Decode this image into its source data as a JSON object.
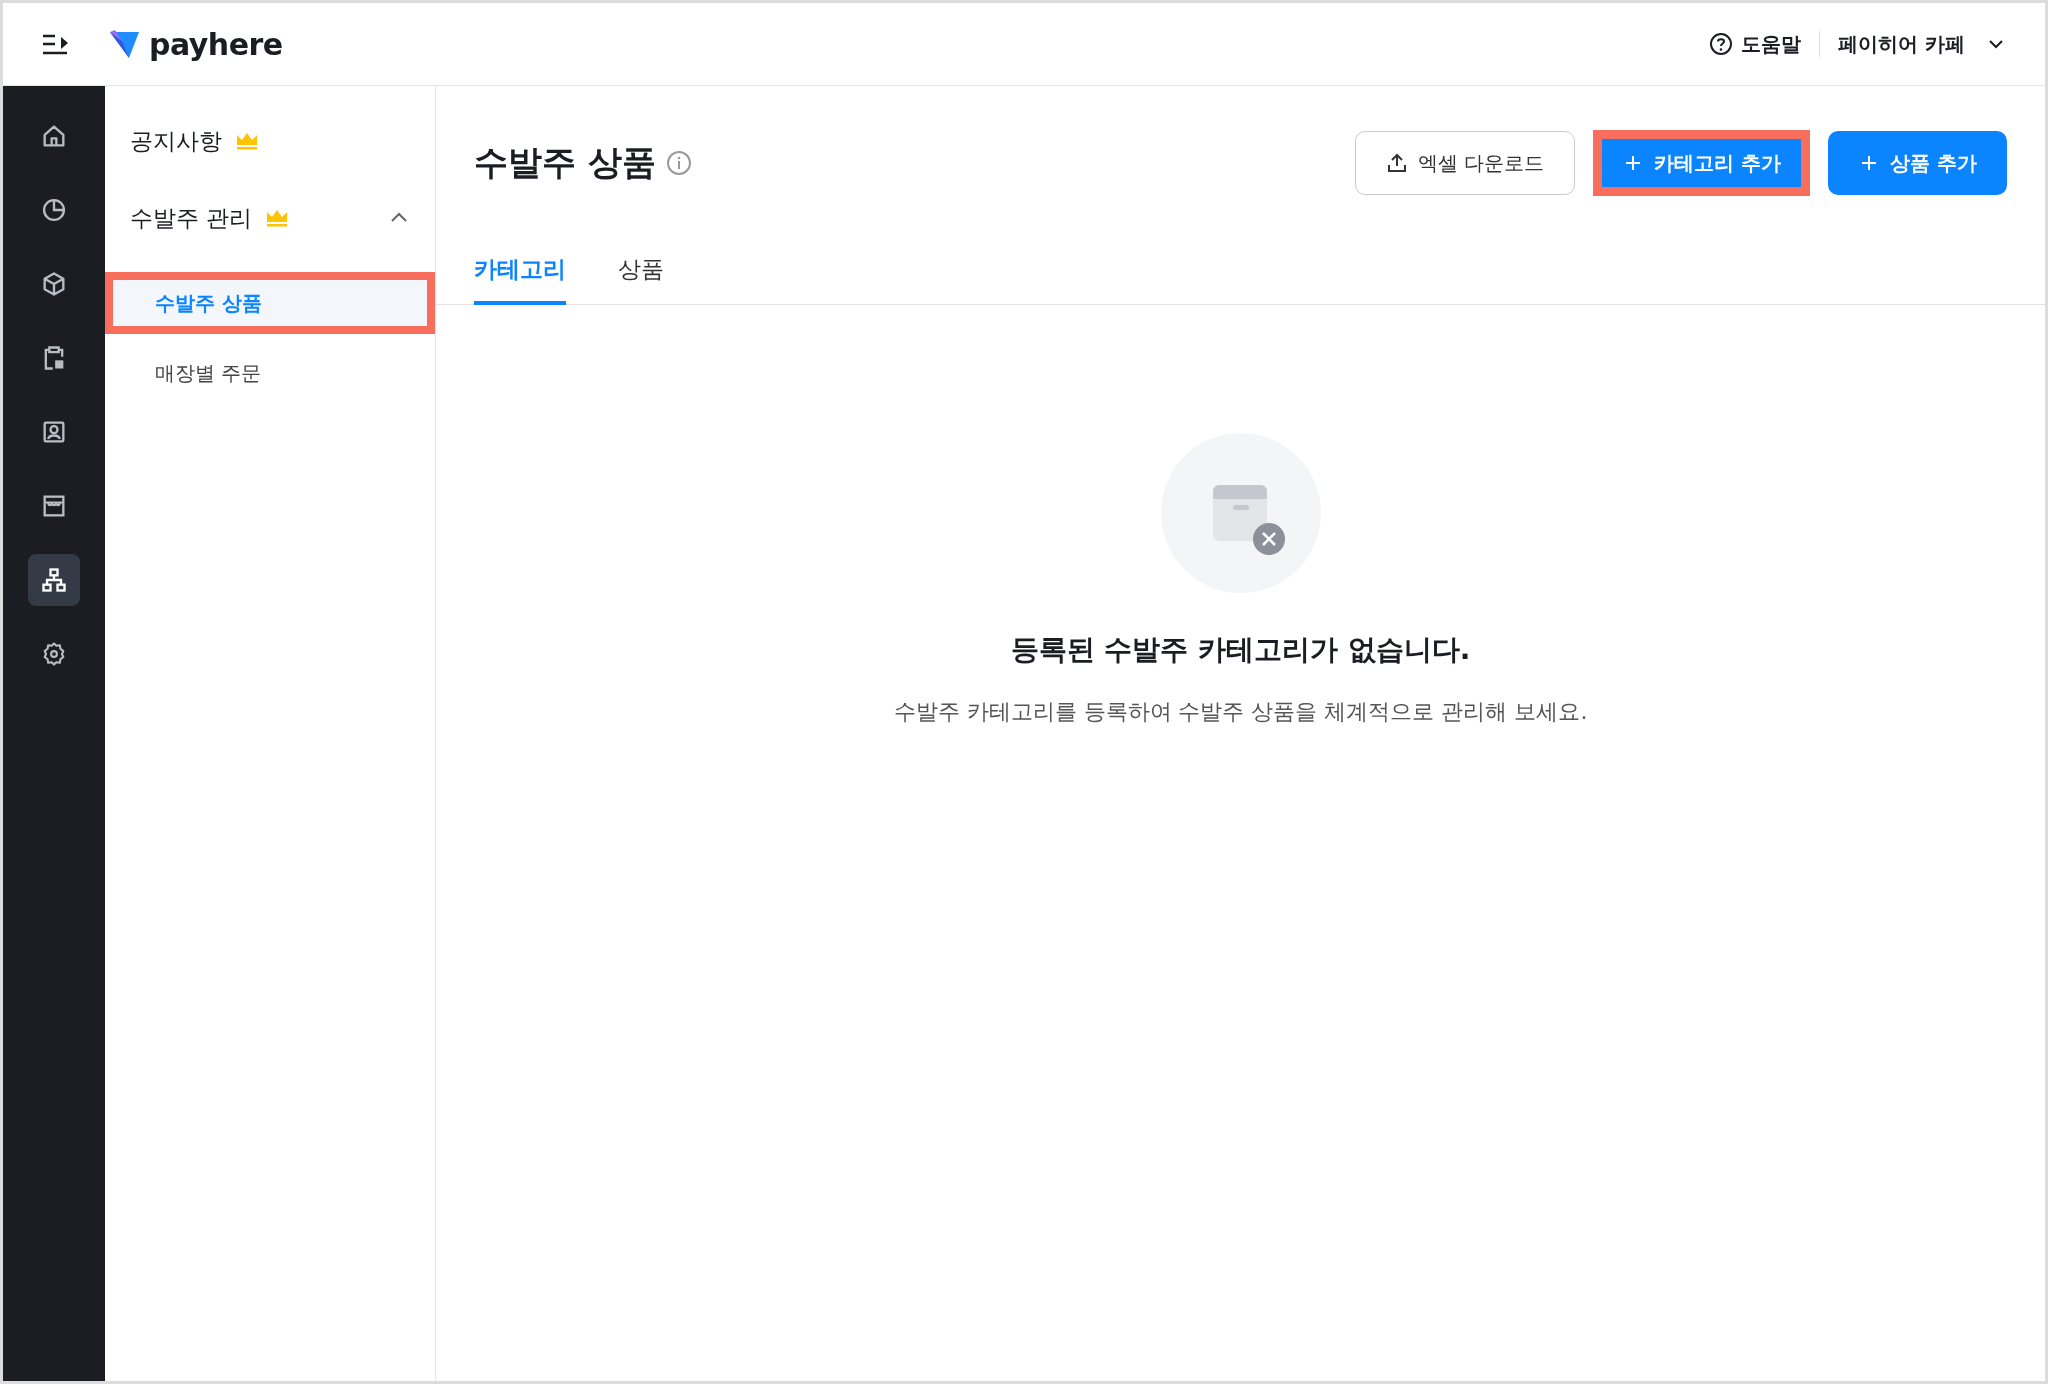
{
  "top_bar": {
    "logo": "payhere",
    "help": "도움말",
    "store": "페이히어 카페"
  },
  "rail": [
    {
      "selected": false
    },
    {
      "selected": false
    },
    {
      "selected": false
    },
    {
      "selected": false
    },
    {
      "selected": false
    },
    {
      "selected": false
    },
    {
      "selected": true
    },
    {
      "selected": false
    }
  ],
  "sidebar": {
    "items": [
      {
        "label": "공지사항",
        "premium": true
      },
      {
        "label": "수발주 관리",
        "premium": true,
        "expanded": true,
        "children": [
          {
            "label": "수발주 상품",
            "selected": true,
            "highlighted": true
          },
          {
            "label": "매장별 주문",
            "selected": false,
            "highlighted": false
          }
        ]
      }
    ]
  },
  "page": {
    "title": "수발주 상품",
    "buttons": [
      {
        "label": "엑셀 다운로드",
        "kind": "outline",
        "highlighted": false
      },
      {
        "label": "카테고리 추가",
        "kind": "primary",
        "highlighted": true
      },
      {
        "label": "상품 추가",
        "kind": "primary",
        "highlighted": false
      }
    ],
    "tabs": [
      {
        "label": "카테고리",
        "selected": true
      },
      {
        "label": "상품",
        "selected": false
      }
    ],
    "empty_state": {
      "title": "등록된 수발주 카테고리가 없습니다.",
      "message": "수발주 카테고리를 등록하여 수발주 상품을 체계적으로 관리해 보세요."
    }
  }
}
